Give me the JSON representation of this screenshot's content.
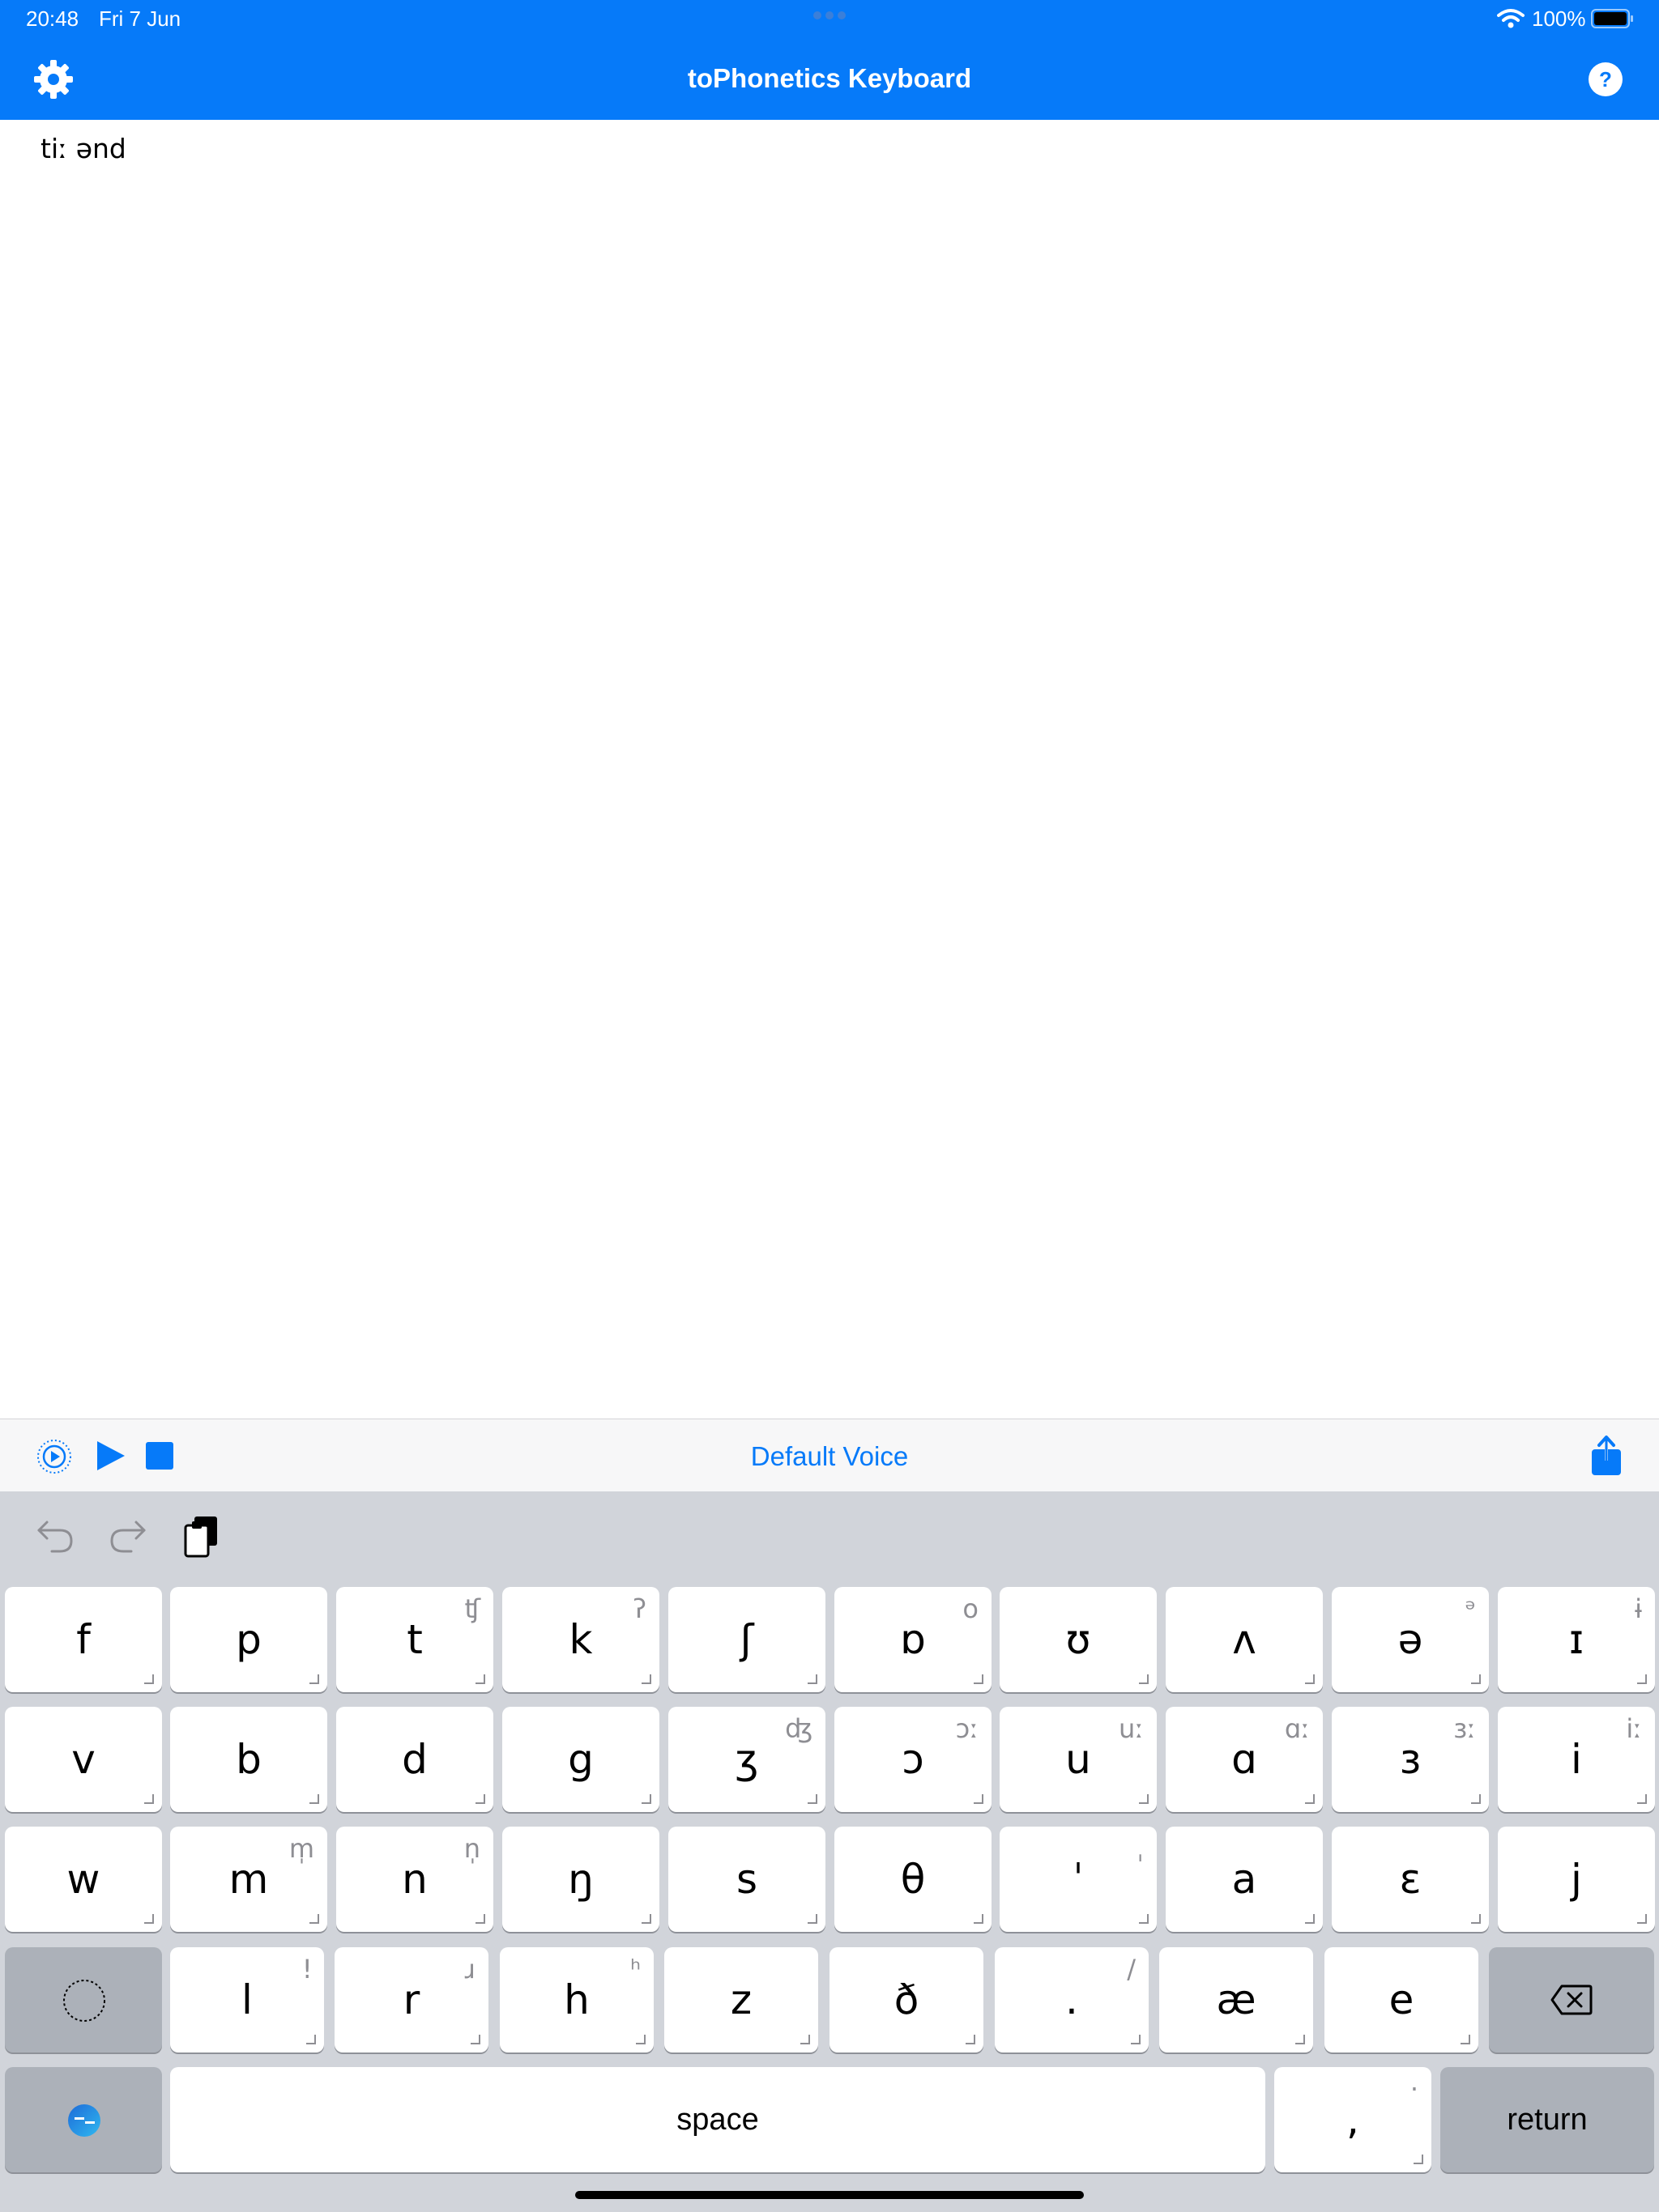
{
  "status_bar": {
    "time": "20:48",
    "date": "Fri 7 Jun",
    "battery": "100%"
  },
  "header": {
    "title": "toPhonetics Keyboard",
    "settings_icon": "gear-icon",
    "help_icon": "question-icon"
  },
  "editor": {
    "text": "tiː ənd"
  },
  "toolbar": {
    "voice": "Default Voice"
  },
  "keyboard": {
    "rows": [
      [
        {
          "m": "f"
        },
        {
          "m": "p"
        },
        {
          "m": "t",
          "s": "ʧ"
        },
        {
          "m": "k",
          "s": "ʔ"
        },
        {
          "m": "ʃ"
        },
        {
          "m": "ɒ",
          "s": "o"
        },
        {
          "m": "ʊ"
        },
        {
          "m": "ʌ"
        },
        {
          "m": "ə",
          "s": "ᵊ"
        },
        {
          "m": "ɪ",
          "s": "ɨ"
        }
      ],
      [
        {
          "m": "v"
        },
        {
          "m": "b"
        },
        {
          "m": "d"
        },
        {
          "m": "g"
        },
        {
          "m": "ʒ",
          "s": "ʤ"
        },
        {
          "m": "ɔ",
          "s": "ɔː"
        },
        {
          "m": "u",
          "s": "uː"
        },
        {
          "m": "ɑ",
          "s": "ɑː"
        },
        {
          "m": "ɜ",
          "s": "ɜː"
        },
        {
          "m": "i",
          "s": "iː"
        }
      ],
      [
        {
          "m": "w"
        },
        {
          "m": "m",
          "s": "m̩"
        },
        {
          "m": "n",
          "s": "n̩"
        },
        {
          "m": "ŋ"
        },
        {
          "m": "s"
        },
        {
          "m": "θ"
        },
        {
          "m": "ˈ",
          "s": "ˌ"
        },
        {
          "m": "a"
        },
        {
          "m": "ɛ"
        },
        {
          "m": "j"
        }
      ],
      [
        {
          "m": "l",
          "s": "ǃ"
        },
        {
          "m": "r",
          "s": "ɹ"
        },
        {
          "m": "h",
          "s": "ʰ"
        },
        {
          "m": "z"
        },
        {
          "m": "ð"
        },
        {
          "m": ".",
          "s": "/"
        },
        {
          "m": "æ"
        },
        {
          "m": "e"
        }
      ],
      [
        {
          "m": "space"
        },
        {
          "m": ",",
          "s": "·"
        },
        {
          "m": "return"
        }
      ]
    ]
  }
}
